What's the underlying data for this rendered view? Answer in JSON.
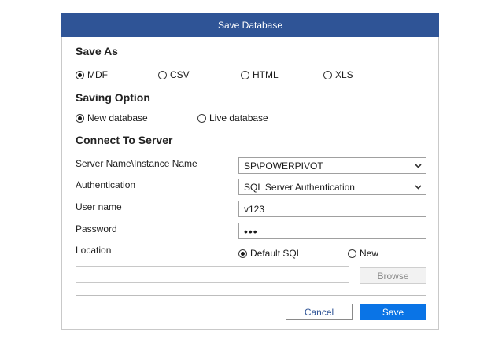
{
  "dialog": {
    "title": "Save Database",
    "colors": {
      "titlebar": "#2f5496",
      "primary_button": "#0a74e6"
    }
  },
  "save_as": {
    "heading": "Save As",
    "options": [
      {
        "label": "MDF",
        "selected": true
      },
      {
        "label": "CSV",
        "selected": false
      },
      {
        "label": "HTML",
        "selected": false
      },
      {
        "label": "XLS",
        "selected": false
      }
    ]
  },
  "saving_option": {
    "heading": "Saving Option",
    "options": [
      {
        "label": "New database",
        "selected": true
      },
      {
        "label": "Live database",
        "selected": false
      }
    ]
  },
  "connect": {
    "heading": "Connect To Server",
    "server_label": "Server Name\\Instance Name",
    "server_value": "SP\\POWERPIVOT",
    "auth_label": "Authentication",
    "auth_value": "SQL Server Authentication",
    "user_label": "User name",
    "user_value": "v123",
    "password_label": "Password",
    "password_value": "•••",
    "location_label": "Location",
    "location_options": [
      {
        "label": "Default SQL",
        "selected": true
      },
      {
        "label": "New",
        "selected": false
      }
    ],
    "browse_path": "",
    "browse_label": "Browse"
  },
  "footer": {
    "cancel_label": "Cancel",
    "save_label": "Save"
  }
}
